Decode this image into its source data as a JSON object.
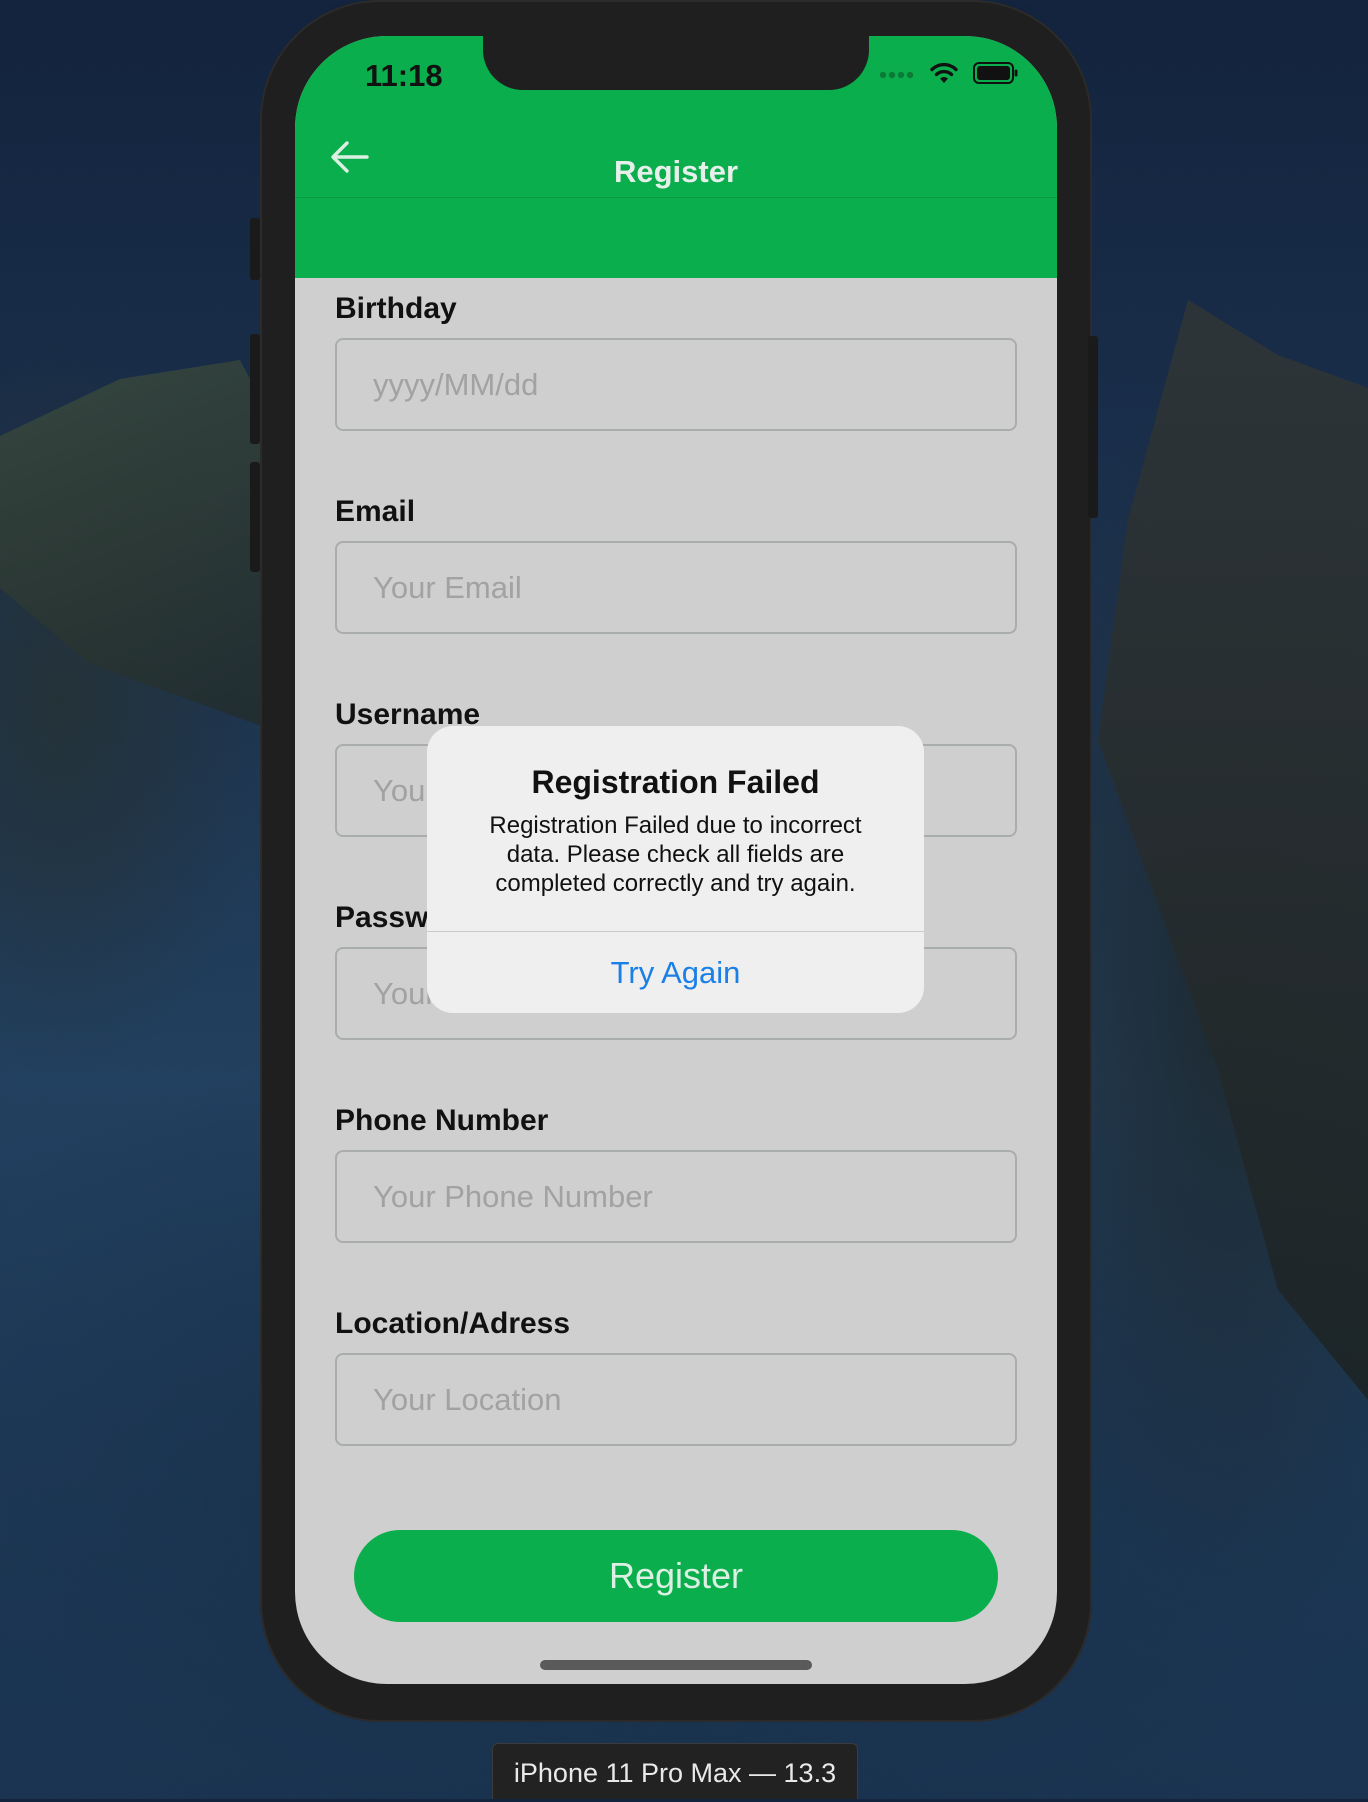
{
  "status_bar": {
    "time": "11:18"
  },
  "nav": {
    "title": "Register",
    "back_icon": "arrow-left-icon"
  },
  "form": {
    "fields": [
      {
        "label": "Birthday",
        "placeholder": "yyyy/MM/dd",
        "value": ""
      },
      {
        "label": "Email",
        "placeholder": "Your Email",
        "value": ""
      },
      {
        "label": "Username",
        "placeholder": "Your Username",
        "value": ""
      },
      {
        "label": "Password",
        "placeholder": "Your Password",
        "value": ""
      },
      {
        "label": "Phone Number",
        "placeholder": "Your Phone Number",
        "value": ""
      },
      {
        "label": "Location/Adress",
        "placeholder": "Your Location",
        "value": ""
      }
    ],
    "submit_label": "Register"
  },
  "alert": {
    "title": "Registration Failed",
    "message": "Registration Failed due to incorrect data. Please check all fields are completed correctly and try again.",
    "action_label": "Try Again"
  },
  "device_label": "iPhone 11 Pro Max — 13.3",
  "colors": {
    "header_green": "#0aae4c",
    "link_blue": "#1a7fe6",
    "screen_gray": "#cfcfcf"
  }
}
